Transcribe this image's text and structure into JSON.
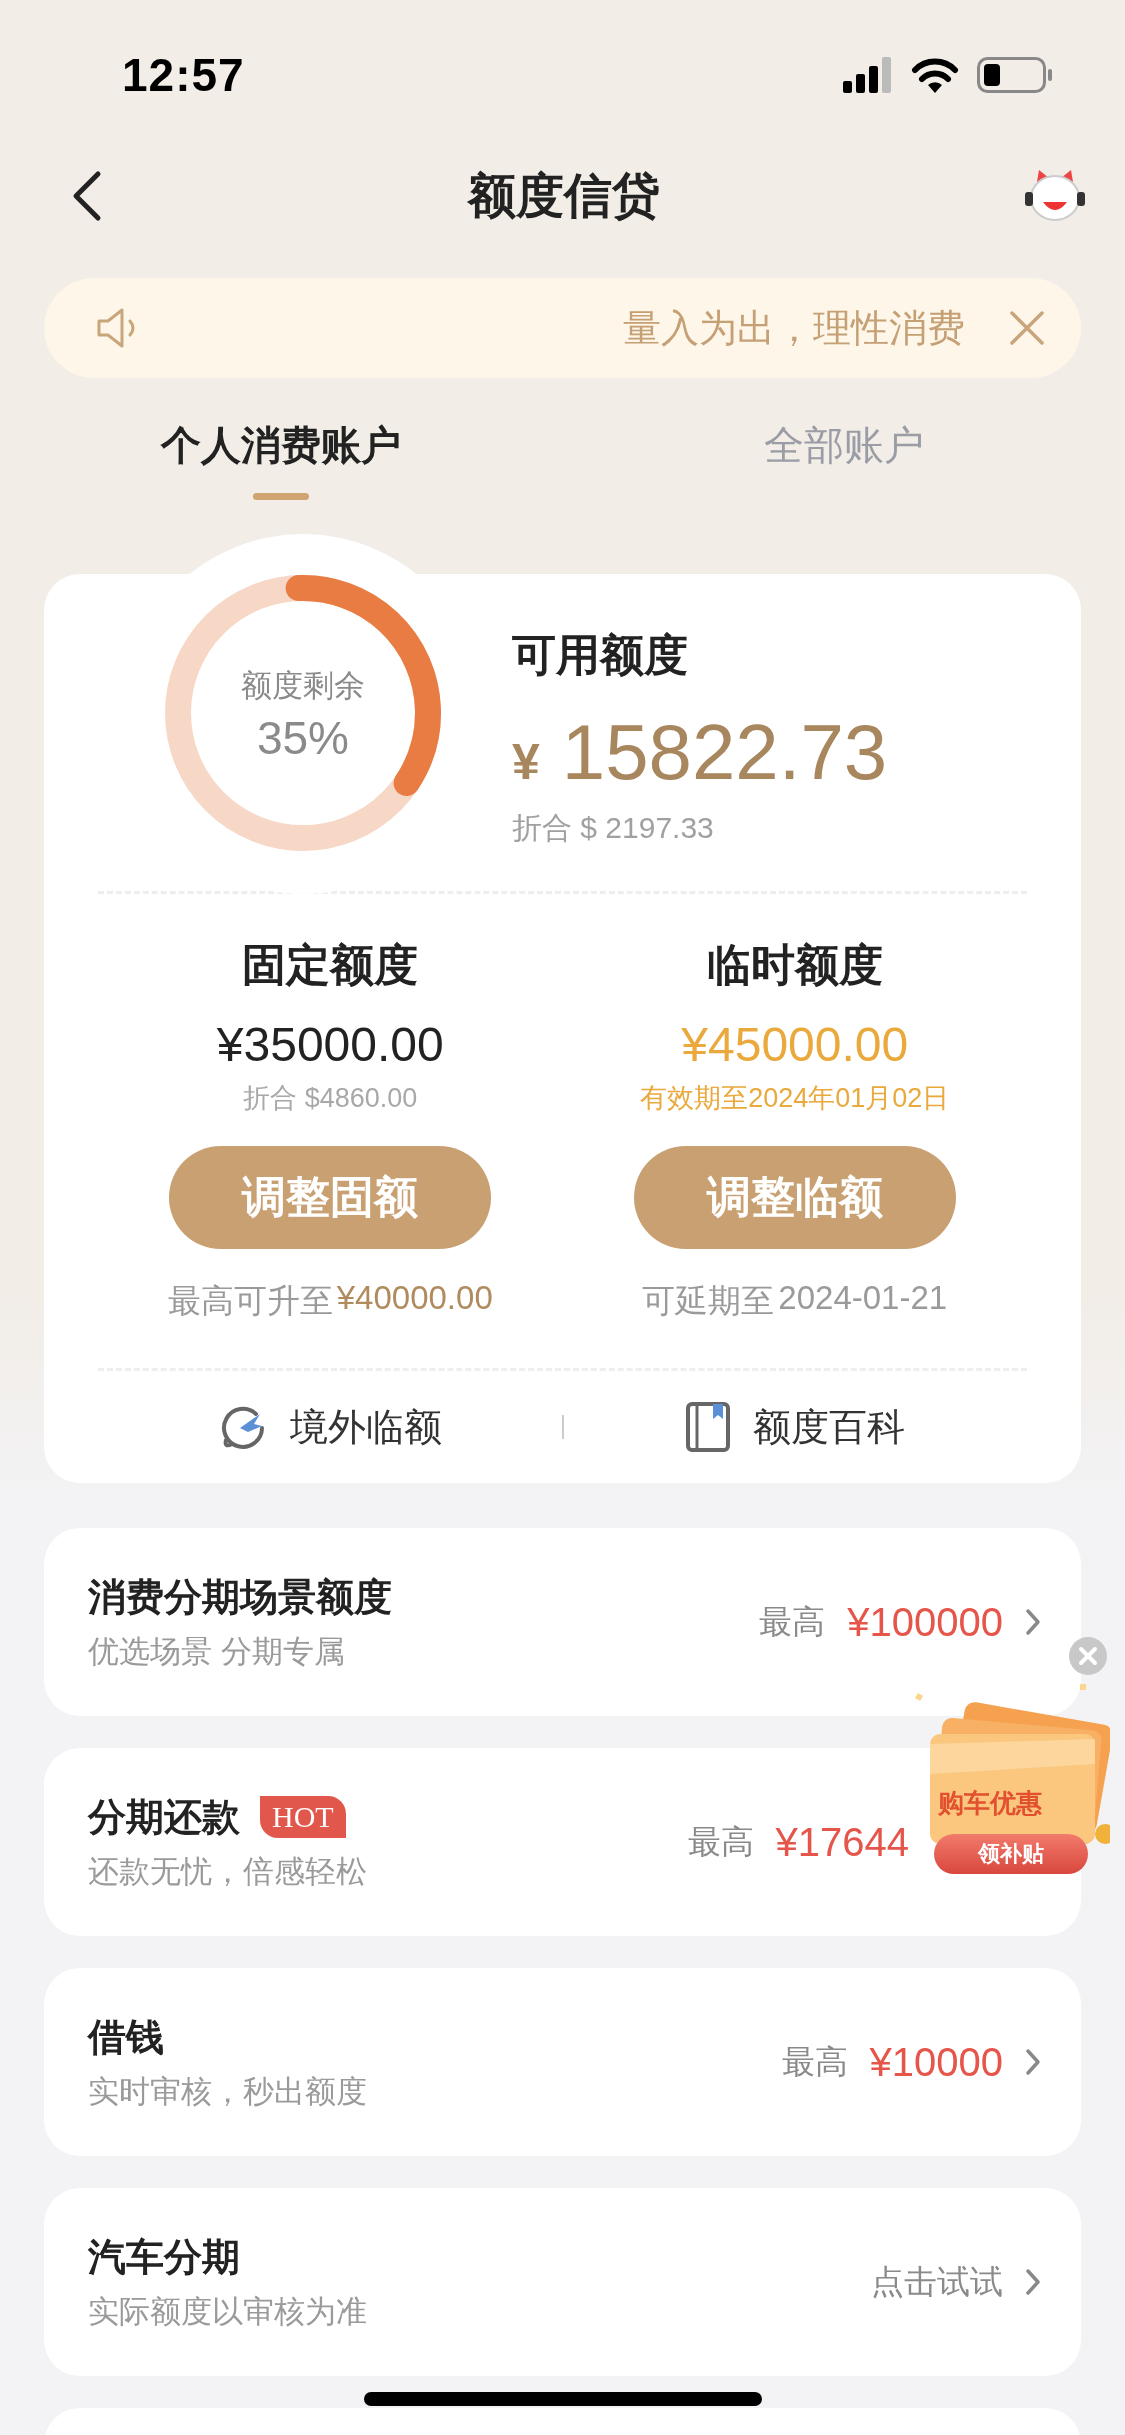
{
  "status_bar": {
    "time": "12:57"
  },
  "nav": {
    "title": "额度信贷"
  },
  "notice": {
    "text": "量入为出，理性消费"
  },
  "tabs": [
    {
      "label": "个人消费账户",
      "selected": true
    },
    {
      "label": "全部账户",
      "selected": false
    }
  ],
  "quota": {
    "ring_label": "额度剩余",
    "ring_percent": "35%",
    "level": 0.35,
    "available_label": "可用额度",
    "currency": "¥",
    "amount": "15822.73",
    "converted": "折合 $ 2197.33",
    "columns": [
      {
        "kind": "fixed",
        "title": "固定额度",
        "amount": "¥35000.00",
        "note": "折合 $4860.00",
        "button": "调整固额",
        "hint_prefix": "最高可升至",
        "hint_value": "¥40000.00"
      },
      {
        "kind": "temporary",
        "title": "临时额度",
        "amount": "¥45000.00",
        "note": "有效期至2024年01月02日",
        "button": "调整临额",
        "hint_prefix": "可延期至",
        "hint_value": "2024-01-21"
      }
    ],
    "links": [
      {
        "kind": "overseas",
        "label": "境外临额"
      },
      {
        "kind": "wiki",
        "label": "额度百科"
      }
    ]
  },
  "products": [
    {
      "title": "消费分期场景额度",
      "subtitle": "优选场景 分期专属",
      "prefix": "最高",
      "value": "¥100000",
      "chevron": true
    },
    {
      "title": "分期还款",
      "badge": "HOT",
      "subtitle": "还款无忧，倍感轻松",
      "prefix": "最高",
      "value": "¥17644",
      "chevron": false
    },
    {
      "title": "借钱",
      "subtitle": "实时审核，秒出额度",
      "prefix": "最高",
      "value": "¥10000",
      "chevron": true
    },
    {
      "title": "汽车分期",
      "subtitle": "实际额度以审核为准",
      "prefix": "点击试试",
      "chevron": true
    }
  ],
  "promo": {
    "title": "购车优惠",
    "button": "领补贴"
  }
}
